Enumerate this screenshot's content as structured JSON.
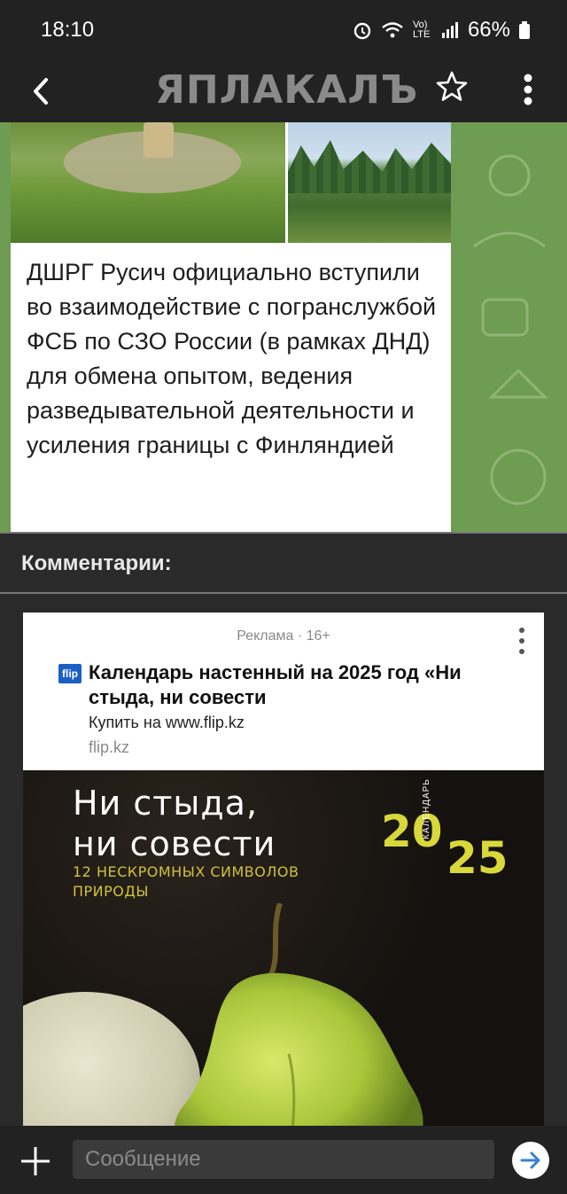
{
  "status_bar": {
    "time": "18:10",
    "network": "Vo) LTE",
    "battery": "66%"
  },
  "app_bar": {
    "logo_text": "ЯПЛАКАЛЪ"
  },
  "post": {
    "text": "ДШРГ Русич официально вступили во взаимодействие с погранслужбой ФСБ по СЗО России (в рамках ДНД) для обмена опытом, ведения разведывательной деятельности и усиления границы с Финляндией"
  },
  "comments": {
    "title": "Комментарии:"
  },
  "ad": {
    "label": "Реклама · 16+",
    "favicon_text": "flip",
    "title": "Календарь настенный на 2025 год «Ни стыда, ни совести",
    "cta": "Купить на www.flip.kz",
    "domain": "flip.kz",
    "image": {
      "headline_line1": "Ни стыда,",
      "headline_line2": "ни совести",
      "sub_line1": "12 НЕСКРОМНЫХ СИМВОЛОВ",
      "sub_line2": "ПРИРОДЫ",
      "year_part1": "20",
      "year_part2": "25",
      "year_vertical": "КАЛЕНДАРЬ"
    }
  },
  "composer": {
    "placeholder": "Сообщение"
  },
  "colors": {
    "bar_bg": "#222222",
    "post_bg": "#6e9c52",
    "accent_year": "#d8d83a",
    "send_arrow": "#3b7fd1"
  }
}
